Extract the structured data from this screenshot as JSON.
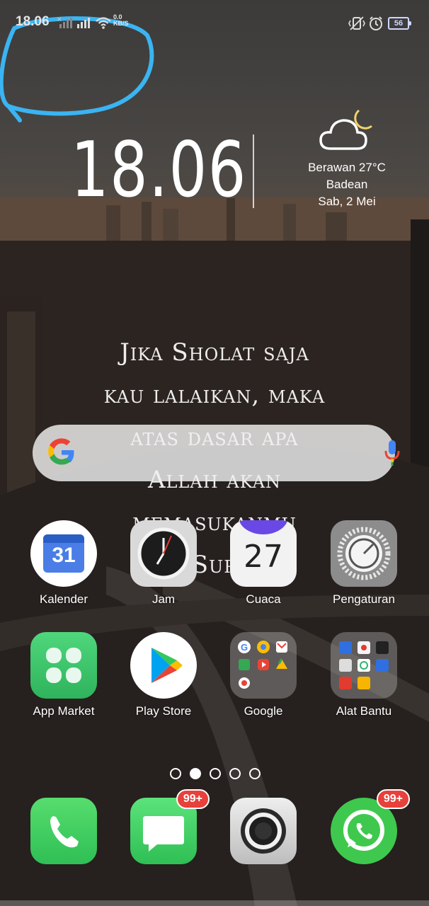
{
  "status_bar": {
    "time": "18.06",
    "net_speed_value": "0.0",
    "net_speed_unit": "KB/S",
    "battery": "56"
  },
  "clock_widget": {
    "time": "18.06",
    "weather_condition": "Berawan 27°C",
    "location": "Badean",
    "date": "Sab, 2 Mei"
  },
  "wallpaper_quote": {
    "lines": [
      "Jika Sholat saja",
      "kau lalaikan, maka",
      "atas dasar apa",
      "Allah akan",
      "memasukanmu",
      "Sur"
    ]
  },
  "apps_row1": [
    {
      "label": "Kalender",
      "icon": "calendar-icon",
      "number": "31"
    },
    {
      "label": "Jam",
      "icon": "clock-icon"
    },
    {
      "label": "Cuaca",
      "icon": "weather-icon",
      "number": "27"
    },
    {
      "label": "Pengaturan",
      "icon": "settings-icon"
    }
  ],
  "apps_row2": [
    {
      "label": "App Market",
      "icon": "app-market-icon"
    },
    {
      "label": "Play Store",
      "icon": "play-store-icon"
    },
    {
      "label": "Google",
      "icon": "folder-icon"
    },
    {
      "label": "Alat Bantu",
      "icon": "folder-icon"
    }
  ],
  "dock": [
    {
      "label": "Phone",
      "icon": "phone-icon"
    },
    {
      "label": "Messages",
      "icon": "message-icon",
      "badge": "99+"
    },
    {
      "label": "Camera",
      "icon": "camera-icon"
    },
    {
      "label": "WhatsApp",
      "icon": "whatsapp-icon",
      "badge": "99+"
    }
  ],
  "page_indicator": {
    "count": 5,
    "active": 1
  },
  "colors": {
    "accent_blue": "#3ab4f2",
    "badge_red": "#e8403a"
  }
}
